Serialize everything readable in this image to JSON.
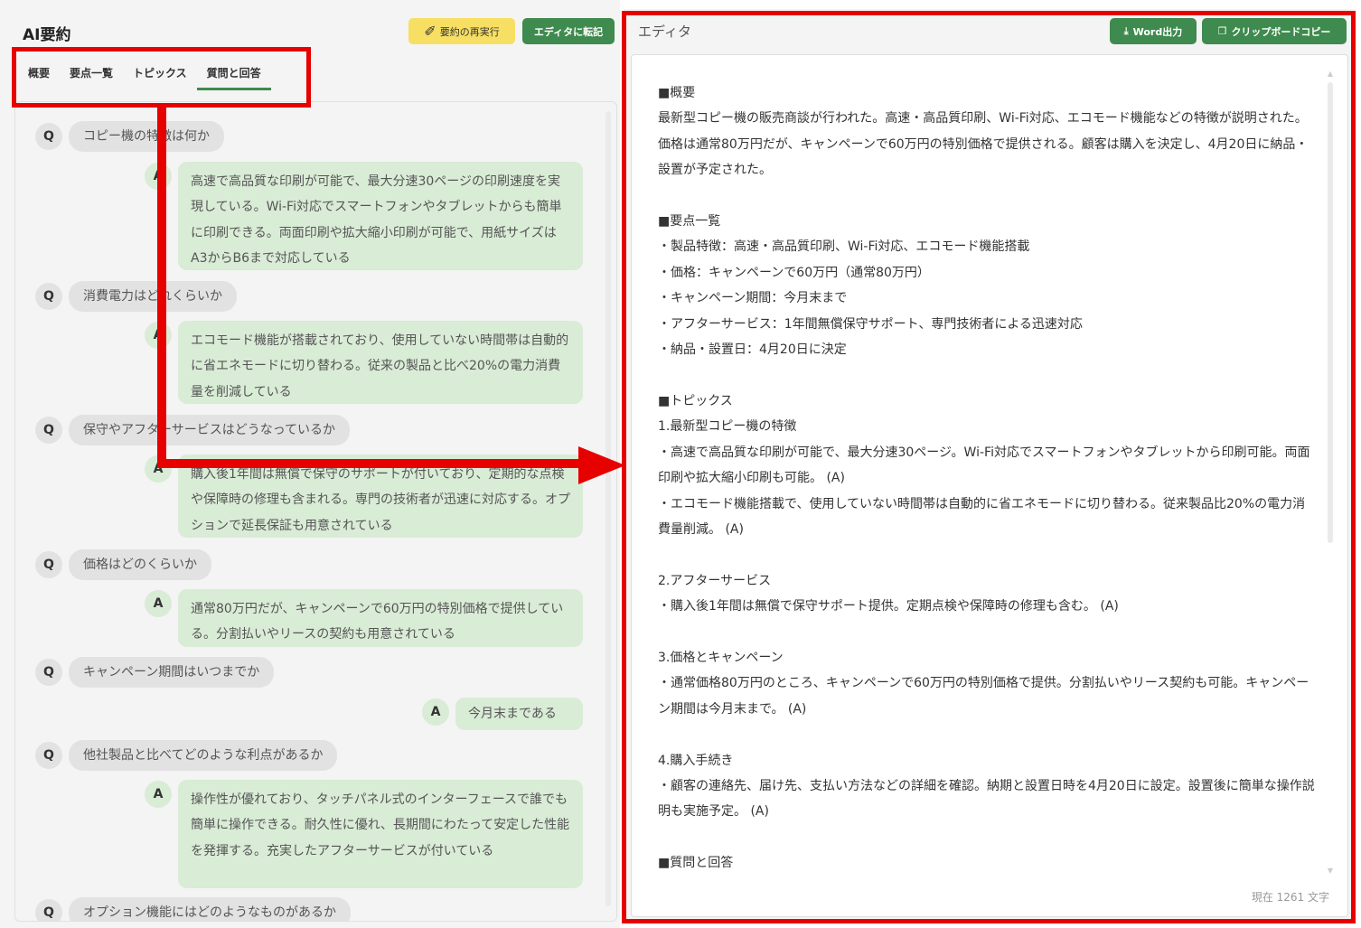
{
  "app": {
    "title": "AI要約",
    "rerun_label": "要約の再実行",
    "transfer_label": "エディタに転記",
    "tabs": [
      "概要",
      "要点一覧",
      "トピックス",
      "質問と回答"
    ],
    "active_tab": "質問と回答"
  },
  "qa": {
    "q_mark": "Q",
    "a_mark": "A",
    "items": [
      {
        "q": "コピー機の特徴は何か",
        "a": "高速で高品質な印刷が可能で、最大分速30ページの印刷速度を実現している。Wi-Fi対応でスマートフォンやタブレットからも簡単に印刷できる。両面印刷や拡大縮小印刷が可能で、用紙サイズはA3からB6まで対応している"
      },
      {
        "q": "消費電力はどれくらいか",
        "a": "エコモード機能が搭載されており、使用していない時間帯は自動的に省エネモードに切り替わる。従来の製品と比べ20%の電力消費量を削減している"
      },
      {
        "q": "保守やアフターサービスはどうなっているか",
        "a": "購入後1年間は無償で保守のサポートが付いており、定期的な点検や保障時の修理も含まれる。専門の技術者が迅速に対応する。オプションで延長保証も用意されている"
      },
      {
        "q": "価格はどのくらいか",
        "a": "通常80万円だが、キャンペーンで60万円の特別価格で提供している。分割払いやリースの契約も用意されている"
      },
      {
        "q": "キャンペーン期間はいつまでか",
        "a": "今月末まである"
      },
      {
        "q": "他社製品と比べてどのような利点があるか",
        "a": "操作性が優れており、タッチパネル式のインターフェースで誰でも簡単に操作できる。耐久性に優れ、長期間にわたって安定した性能を発揮する。充実したアフターサービスが付いている"
      },
      {
        "q": "オプション機能にはどのようなものがあるか",
        "a": ""
      }
    ]
  },
  "editor": {
    "title": "エディタ",
    "word_label": "Word出力",
    "copy_label": "クリップボードコピー",
    "char_count": "現在 1261 文字",
    "lines": [
      "■概要",
      "最新型コピー機の販売商談が行われた。高速・高品質印刷、Wi-Fi対応、エコモード機能などの特徴が説明された。価格は通常80万円だが、キャンペーンで60万円の特別価格で提供される。顧客は購入を決定し、4月20日に納品・設置が予定された。",
      "",
      "■要点一覧",
      "・製品特徴：高速・高品質印刷、Wi-Fi対応、エコモード機能搭載",
      "・価格：キャンペーンで60万円（通常80万円）",
      "・キャンペーン期間：今月末まで",
      "・アフターサービス：1年間無償保守サポート、専門技術者による迅速対応",
      "・納品・設置日：4月20日に決定",
      "",
      "■トピックス",
      "1.最新型コピー機の特徴",
      "・高速で高品質な印刷が可能で、最大分速30ページ。Wi-Fi対応でスマートフォンやタブレットから印刷可能。両面印刷や拡大縮小印刷も可能。 (A)",
      "・エコモード機能搭載で、使用していない時間帯は自動的に省エネモードに切り替わる。従来製品比20%の電力消費量削減。 (A)",
      "",
      "2.アフターサービス",
      "・購入後1年間は無償で保守サポート提供。定期点検や保障時の修理も含む。 (A)",
      "",
      "3.価格とキャンペーン",
      "・通常価格80万円のところ、キャンペーンで60万円の特別価格で提供。分割払いやリース契約も可能。キャンペーン期間は今月末まで。 (A)",
      "",
      "4.購入手続き",
      "・顧客の連絡先、届け先、支払い方法などの詳細を確認。納期と設置日時を4月20日に設定。設置後に簡単な操作説明も実施予定。 (A)",
      "",
      "■質問と回答"
    ]
  },
  "colors": {
    "accent_green": "#3f8a4e",
    "rerun_yellow": "#f7df63",
    "answer_bubble": "#d9ecd6",
    "question_bubble": "#e2e2e2",
    "highlight_red": "#e60000"
  },
  "icons": {
    "rerun": "magic-wand-icon",
    "word": "download-icon",
    "copy": "copy-icon"
  }
}
